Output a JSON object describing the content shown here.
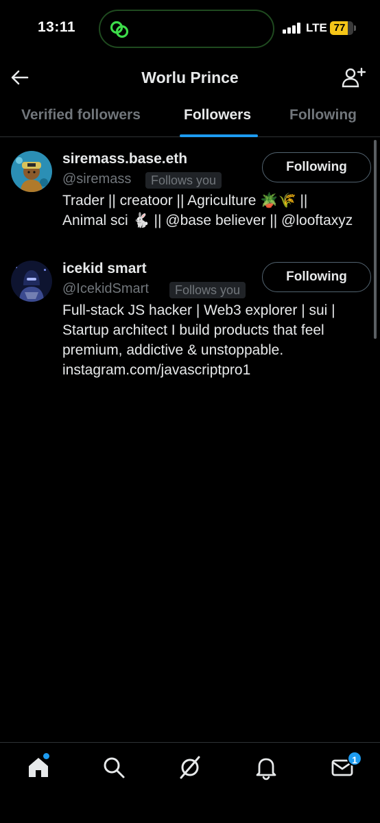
{
  "status_bar": {
    "time": "13:11",
    "network": "LTE",
    "battery_level": "77",
    "battery_fraction": 0.77,
    "battery_color": "#f5c518"
  },
  "header": {
    "title": "Worlu Prince",
    "back_icon": "arrow-left-icon",
    "action_icon": "add-user-icon"
  },
  "tabs": [
    {
      "label": "Verified followers",
      "active": false
    },
    {
      "label": "Followers",
      "active": true
    },
    {
      "label": "Following",
      "active": false
    }
  ],
  "followers": [
    {
      "name": "siremass.base.eth",
      "handle": "@siremass",
      "badge": "Follows you",
      "button": "Following",
      "bio_lines": [
        "Trader || creatoor || Agriculture 🪴🌾 ||",
        "Animal sci 🐇 || @base believer || @looftaxyz"
      ]
    },
    {
      "name": "icekid smart",
      "handle": "@IcekidSmart",
      "badge": "Follows you",
      "button": "Following",
      "bio_lines": [
        "Full-stack JS hacker | Web3 explorer | sui |",
        "Startup architect I build products that feel",
        "premium, addictive & unstoppable.",
        "instagram.com/javascriptpro1"
      ]
    }
  ],
  "bottom_nav": {
    "items": [
      "home-icon",
      "search-icon",
      "grok-icon",
      "notifications-icon",
      "messages-icon"
    ],
    "messages_badge": "1"
  },
  "colors": {
    "accent": "#1d9bf0",
    "background": "#000000",
    "muted_text": "#71767b"
  }
}
